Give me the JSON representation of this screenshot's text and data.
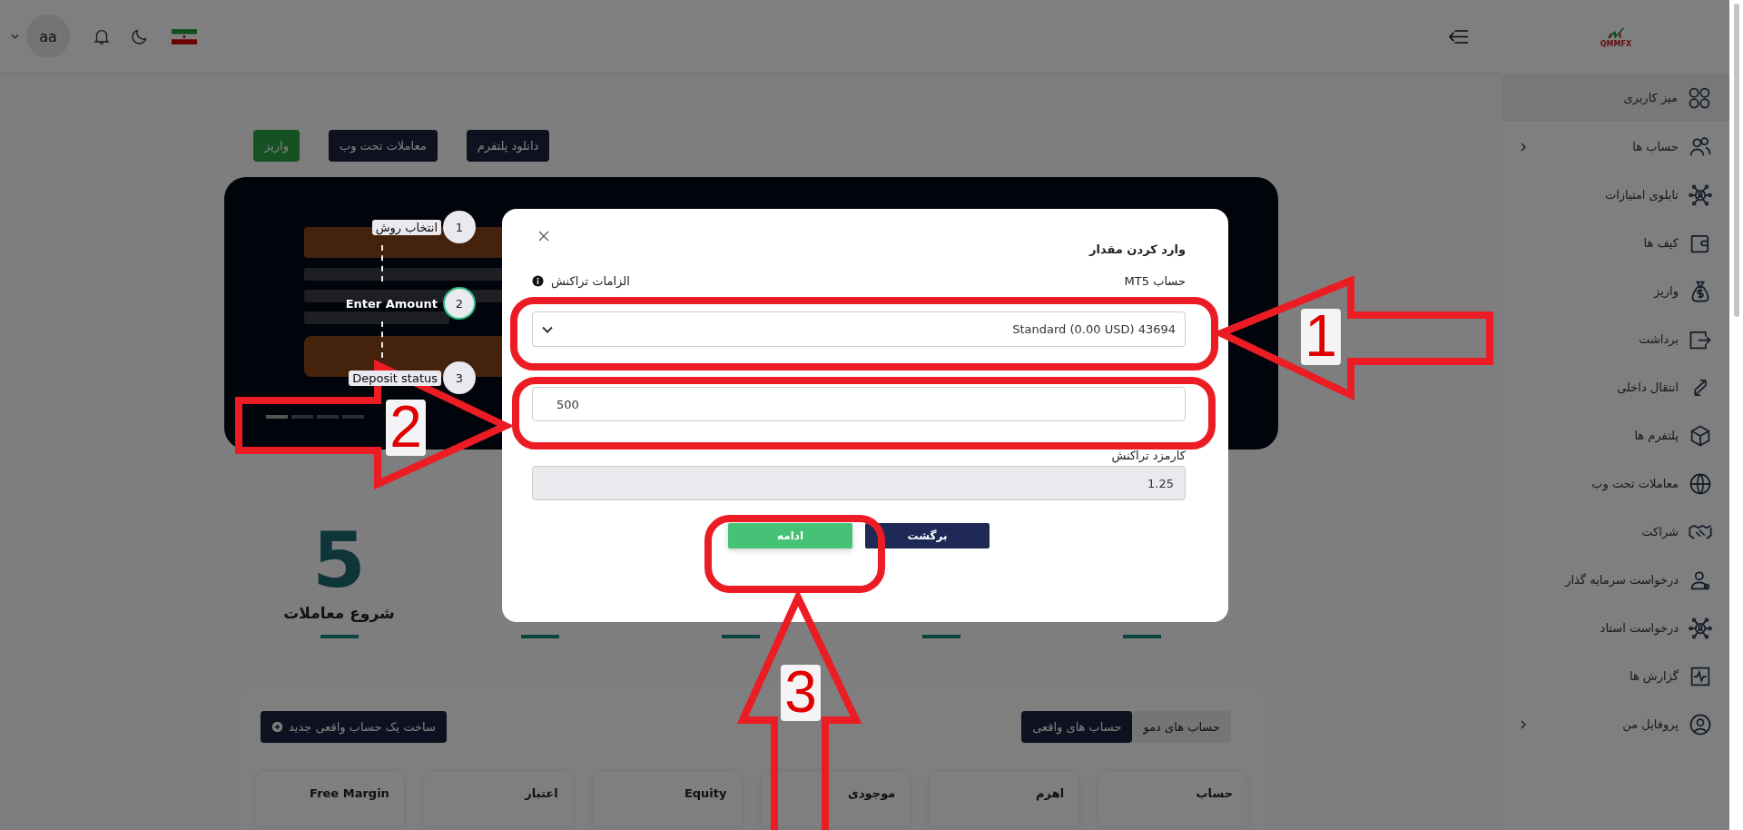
{
  "topbar": {
    "avatar": "aa"
  },
  "sidebar": {
    "brand": "QMMFX",
    "items": [
      {
        "label": "میز کاربری",
        "selected": true,
        "expandable": false
      },
      {
        "label": "حساب ها",
        "selected": false,
        "expandable": true
      },
      {
        "label": "تابلوی امتیازات",
        "selected": false,
        "expandable": false
      },
      {
        "label": "کیف ها",
        "selected": false,
        "expandable": false
      },
      {
        "label": "واریز",
        "selected": false,
        "expandable": false
      },
      {
        "label": "برداشت",
        "selected": false,
        "expandable": false
      },
      {
        "label": "انتقال داخلی",
        "selected": false,
        "expandable": false
      },
      {
        "label": "پلتفرم ها",
        "selected": false,
        "expandable": false
      },
      {
        "label": "معاملات تحت وب",
        "selected": false,
        "expandable": false
      },
      {
        "label": "شراکت",
        "selected": false,
        "expandable": false
      },
      {
        "label": "درخواست سرمایه گذار",
        "selected": false,
        "expandable": false
      },
      {
        "label": "درخواست استاد",
        "selected": false,
        "expandable": false
      },
      {
        "label": "گزارش ها",
        "selected": false,
        "expandable": false
      },
      {
        "label": "پروفایل من",
        "selected": false,
        "expandable": true
      }
    ]
  },
  "actions": [
    {
      "label": "دانلود پلتفرم",
      "kind": "primary"
    },
    {
      "label": "معاملات تحت وب",
      "kind": "primary"
    },
    {
      "label": "واریز",
      "kind": "success"
    }
  ],
  "banner": {
    "kind": "picture",
    "slides": [
      {
        "selected": true
      },
      {
        "selected": false
      },
      {
        "selected": false
      },
      {
        "selected": false
      }
    ]
  },
  "tour": [
    {
      "number": "1",
      "label": "انتخاب روش",
      "selected": false
    },
    {
      "number": "2",
      "label": "Enter Amount",
      "selected": true
    },
    {
      "number": "3",
      "label": "Deposit status",
      "selected": false
    }
  ],
  "progress": {
    "number": "5",
    "label": "شروع معاملات"
  },
  "accounts": {
    "tabs": [
      {
        "label": "حساب های دمو",
        "selected": false
      },
      {
        "label": "حساب های واقعی",
        "selected": true
      }
    ],
    "create_button": "ساخت یک حساب واقعی جدید",
    "columns": [
      "حساب",
      "اهرم",
      "موجودی",
      "Equity",
      "اعتبار",
      "Free Margin"
    ]
  },
  "modal": {
    "title": "وارد کردن مقدار",
    "account_label": "حساب MT5",
    "requirements_link": "الزامات تراکنش",
    "account_select": {
      "value": "Standard (0.00 USD) 43694"
    },
    "amount": {
      "value": "500"
    },
    "fee_label": "کارمزد تراکنش",
    "fee": {
      "value": "1.25",
      "disabled": true
    },
    "buttons": [
      {
        "label": "برگشت",
        "kind": "secondary"
      },
      {
        "label": "ادامه",
        "kind": "primary"
      }
    ]
  },
  "annotations": [
    {
      "number": "1"
    },
    {
      "number": "2"
    },
    {
      "number": "3"
    }
  ]
}
